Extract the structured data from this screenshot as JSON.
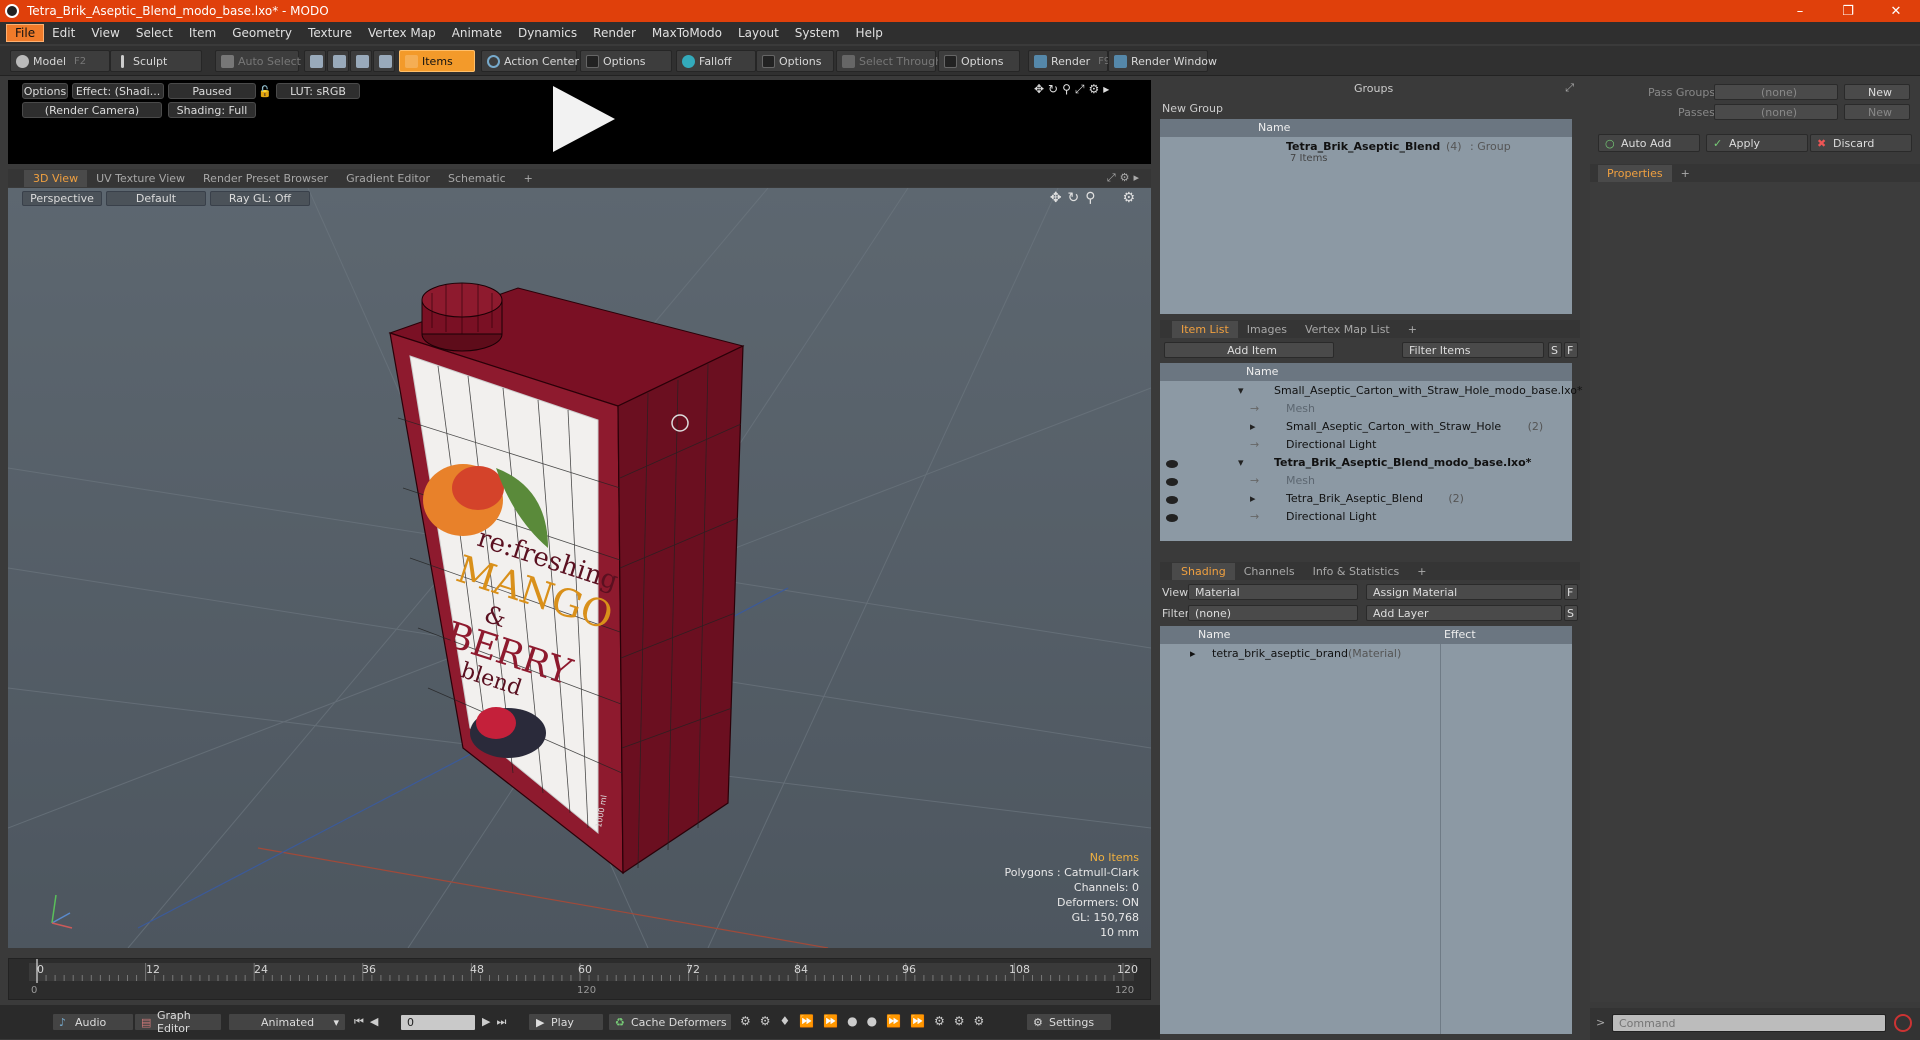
{
  "window": {
    "title": "Tetra_Brik_Aseptic_Blend_modo_base.lxo* - MODO"
  },
  "menu": [
    "File",
    "Edit",
    "View",
    "Select",
    "Item",
    "Geometry",
    "Texture",
    "Vertex Map",
    "Animate",
    "Dynamics",
    "Render",
    "MaxToModo",
    "Layout",
    "System",
    "Help"
  ],
  "toolbar": {
    "model": "Model",
    "model_key": "F2",
    "sculpt": "Sculpt",
    "auto_select": "Auto Select",
    "items": "Items",
    "action_center": "Action Center",
    "options1": "Options",
    "falloff": "Falloff",
    "options2": "Options",
    "select_through": "Select Through",
    "options3": "Options",
    "render": "Render",
    "render_key": "F9",
    "render_window": "Render Window"
  },
  "preview": {
    "options": "Options",
    "effect": "Effect: (Shadi...",
    "paused": "Paused",
    "lut": "LUT: sRGB",
    "camera": "(Render Camera)",
    "shading": "Shading: Full"
  },
  "view_tabs": [
    "3D View",
    "UV Texture View",
    "Render Preset Browser",
    "Gradient Editor",
    "Schematic",
    "+"
  ],
  "viewport": {
    "perspective": "Perspective",
    "default": "Default",
    "raygl": "Ray GL: Off",
    "stats": {
      "no_items": "No Items",
      "polygons": "Polygons : Catmull-Clark",
      "channels": "Channels: 0",
      "deformers": "Deformers: ON",
      "gl": "GL: 150,768",
      "scale": "10 mm"
    }
  },
  "carton": {
    "line1": "re:freshing",
    "line2": "MANGO",
    "line3": "&",
    "line4": "BERRY",
    "line5": "blend",
    "volume": "1000 ml"
  },
  "timeline": {
    "ticks": [
      "0",
      "12",
      "24",
      "36",
      "48",
      "60",
      "72",
      "84",
      "96",
      "108",
      "120"
    ],
    "sub_start": "0",
    "sub_mid": "120",
    "sub_end": "120"
  },
  "transport": {
    "audio": "Audio",
    "graph_editor": "Graph Editor",
    "animated": "Animated",
    "frame": "0",
    "play": "Play",
    "cache_deformers": "Cache Deformers",
    "settings": "Settings"
  },
  "groups": {
    "title": "Groups",
    "new_group": "New Group",
    "name_col": "Name",
    "item_name": "Tetra_Brik_Aseptic_Blend",
    "item_count": "(4)",
    "item_type": ": Group",
    "item_sub": "7 Items"
  },
  "right_top": {
    "pass_groups": "Pass Groups",
    "passes": "Passes",
    "none1": "(none)",
    "none2": "(none)",
    "new1": "New",
    "new2": "New",
    "auto_add": "Auto Add",
    "apply": "Apply",
    "discard": "Discard",
    "properties": "Properties",
    "plus": "+"
  },
  "item_tabs": [
    "Item List",
    "Images",
    "Vertex Map List",
    "+"
  ],
  "item_list": {
    "add_item": "Add Item",
    "filter": "Filter Items",
    "s": "S",
    "f": "F",
    "name_col": "Name",
    "rows": [
      {
        "label": "Small_Aseptic_Carton_with_Straw_Hole_modo_base.lxo*",
        "indent": 0,
        "bold": false,
        "dim": false,
        "count": ""
      },
      {
        "label": "Mesh",
        "indent": 2,
        "bold": false,
        "dim": true,
        "count": ""
      },
      {
        "label": "Small_Aseptic_Carton_with_Straw_Hole",
        "indent": 1,
        "bold": false,
        "dim": false,
        "count": "(2)"
      },
      {
        "label": "Directional Light",
        "indent": 2,
        "bold": false,
        "dim": false,
        "count": ""
      },
      {
        "label": "Tetra_Brik_Aseptic_Blend_modo_base.lxo*",
        "indent": 0,
        "bold": true,
        "dim": false,
        "count": ""
      },
      {
        "label": "Mesh",
        "indent": 2,
        "bold": false,
        "dim": true,
        "count": ""
      },
      {
        "label": "Tetra_Brik_Aseptic_Blend",
        "indent": 1,
        "bold": false,
        "dim": false,
        "count": "(2)"
      },
      {
        "label": "Directional Light",
        "indent": 2,
        "bold": false,
        "dim": false,
        "count": ""
      }
    ]
  },
  "shading_tabs": [
    "Shading",
    "Channels",
    "Info & Statistics",
    "+"
  ],
  "shading": {
    "view_label": "View",
    "view_value": "Material",
    "assign": "Assign Material",
    "f": "F",
    "filter_label": "Filter",
    "filter_value": "(none)",
    "add_layer": "Add Layer",
    "s": "S",
    "name_col": "Name",
    "effect_col": "Effect",
    "row_name": "tetra_brik_aseptic_brand",
    "row_type": "(Material)"
  },
  "command": {
    "placeholder": "Command"
  }
}
